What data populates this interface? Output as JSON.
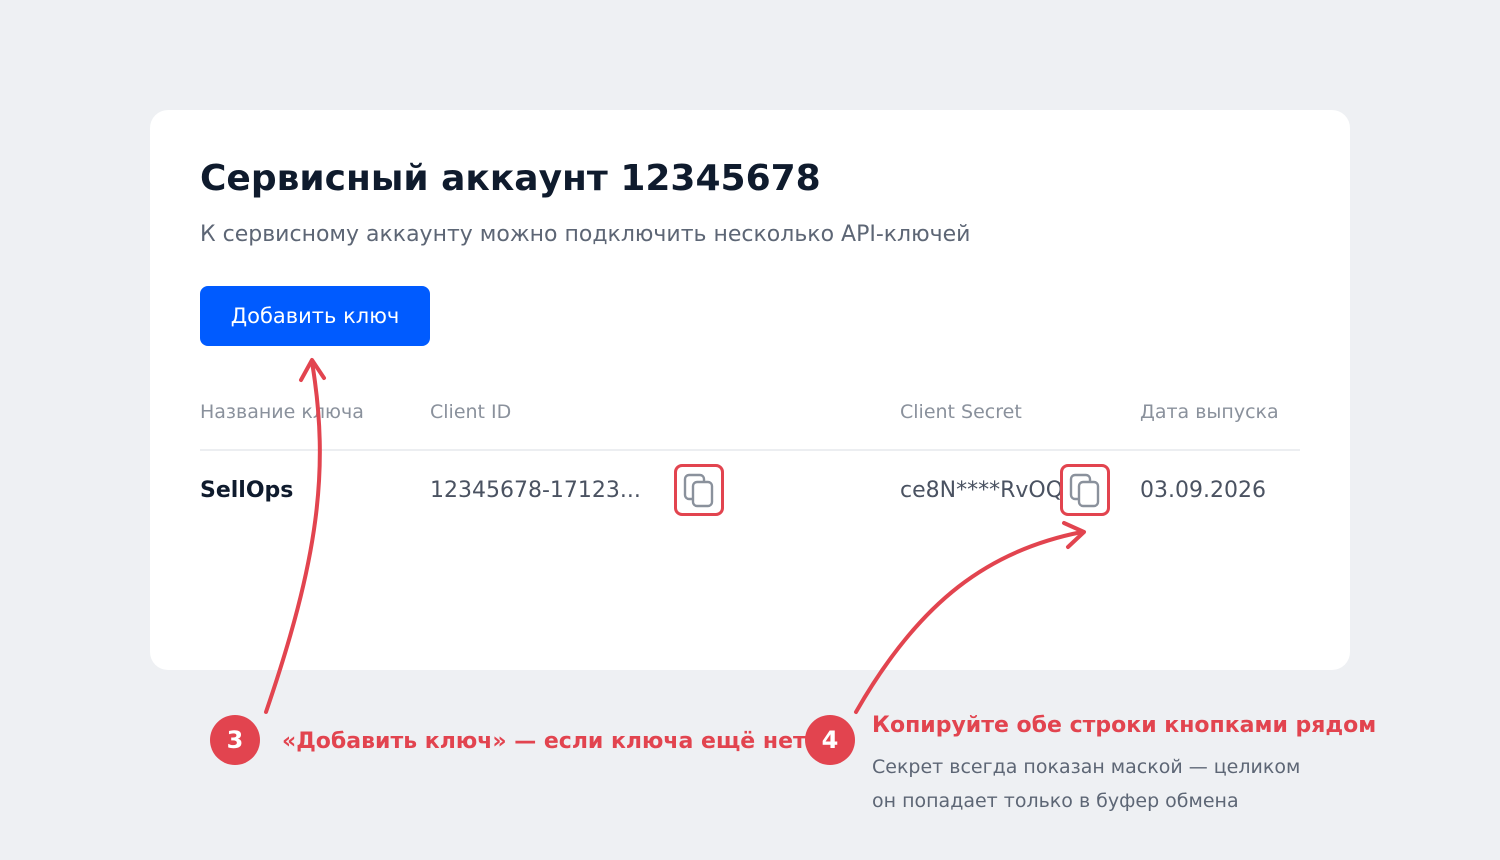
{
  "card": {
    "title": "Сервисный аккаунт 12345678",
    "subtitle": "К сервисному аккаунту можно подключить несколько API-ключей",
    "add_button_label": "Добавить ключ"
  },
  "table": {
    "columns": [
      "Название ключа",
      "Client ID",
      "Client Secret",
      "Дата выпуска"
    ],
    "rows": [
      {
        "name": "SellOps",
        "client_id": "12345678-17123...",
        "client_secret": "ce8N****RvOQ",
        "issue_date": "03.09.2026"
      }
    ]
  },
  "annotations": [
    {
      "number": "3",
      "text": "«Добавить ключ» — если ключа ещё нет"
    },
    {
      "number": "4",
      "text": "Копируйте обе строки кнопками рядом",
      "note_lines": [
        "Секрет всегда показан маской — целиком",
        "он попадает только в буфер обмена"
      ]
    }
  ],
  "colors": {
    "background": "#eef0f3",
    "primary": "#005bff",
    "accent": "#e2444f",
    "title": "#0f1b2d",
    "muted": "#8a919c"
  },
  "icons": {
    "copy": "copy-icon"
  }
}
